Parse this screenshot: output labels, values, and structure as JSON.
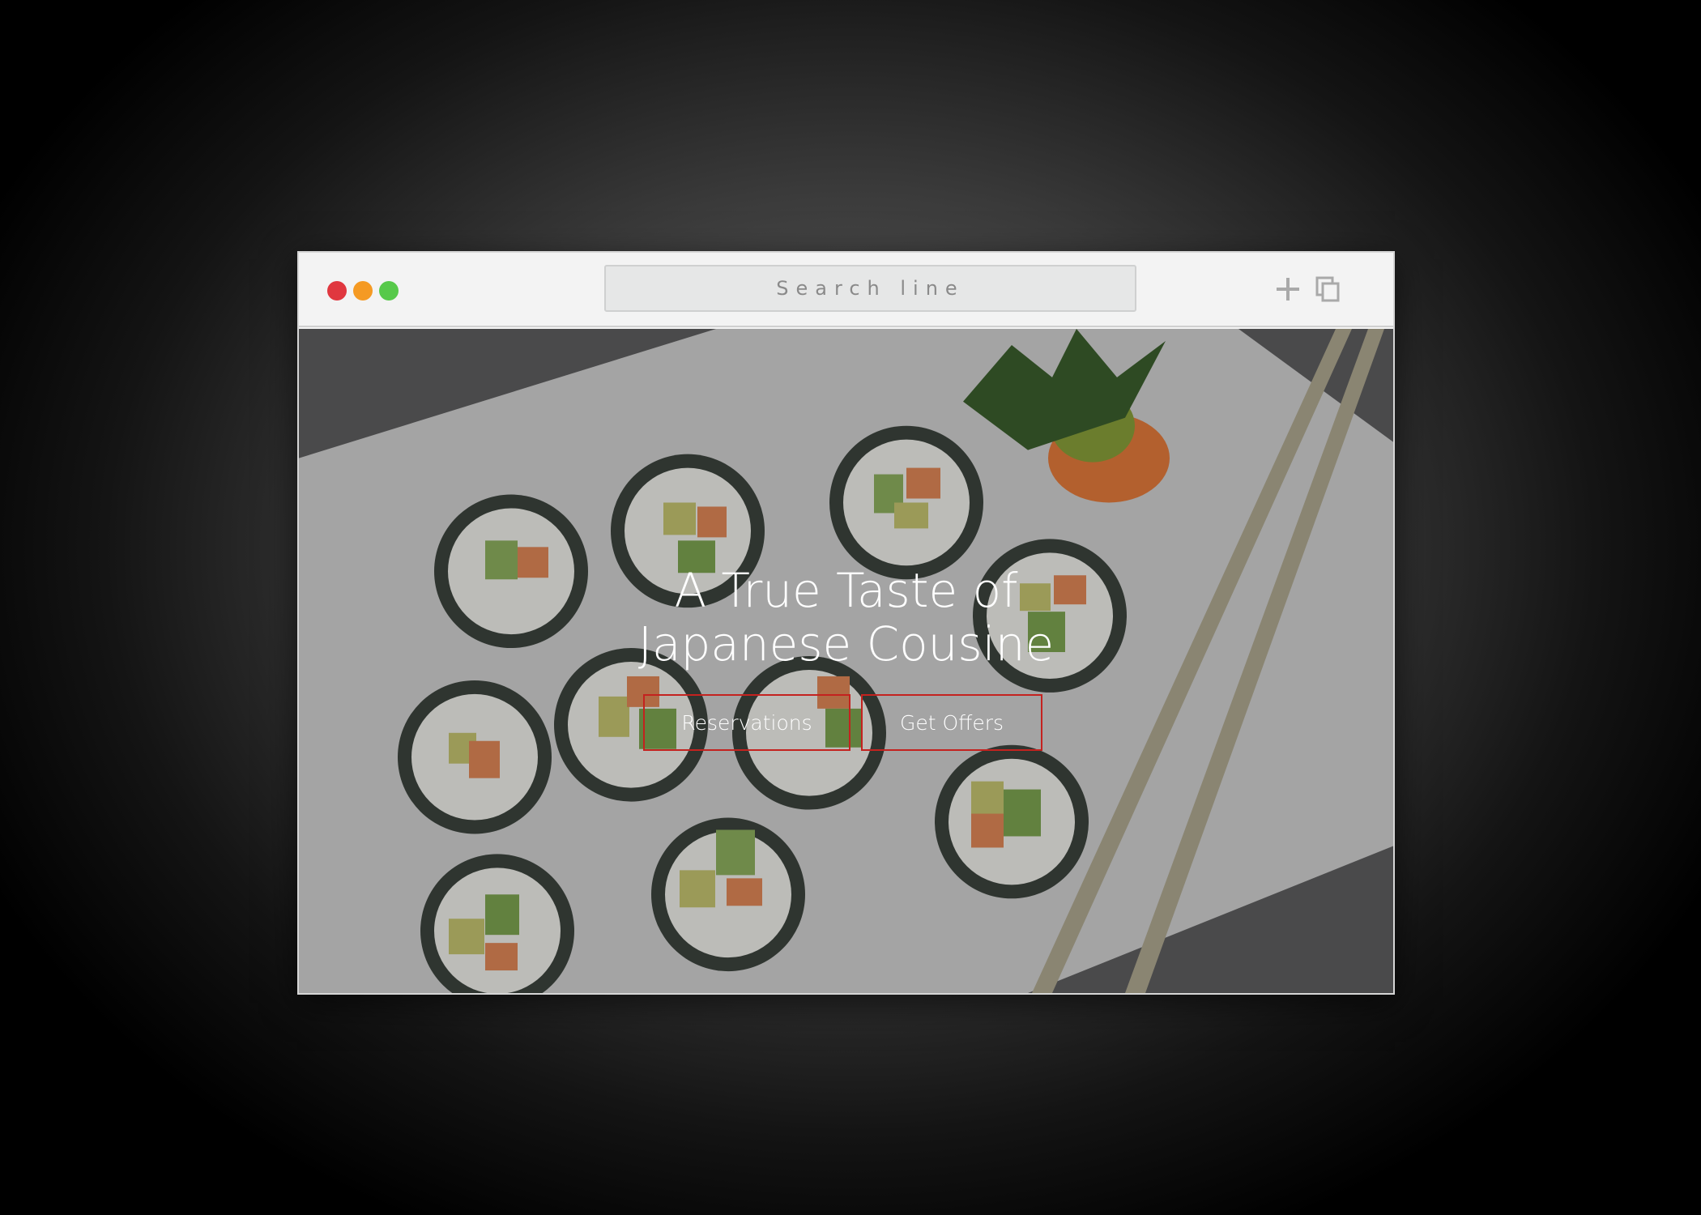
{
  "browser": {
    "search_placeholder": "Search line",
    "traffic_lights": {
      "close": "#e0373f",
      "minimize": "#f59a23",
      "maximize": "#57c94a"
    },
    "icons": [
      "plus-icon",
      "copy-icon"
    ]
  },
  "hero": {
    "headline_line1": "A True Taste of",
    "headline_line2": "Japanese Cousine",
    "buttons": {
      "reservations": "Reservations",
      "offers": "Get Offers"
    },
    "accent_color": "#c4221f",
    "background_image": "sushi-rolls-photo"
  }
}
